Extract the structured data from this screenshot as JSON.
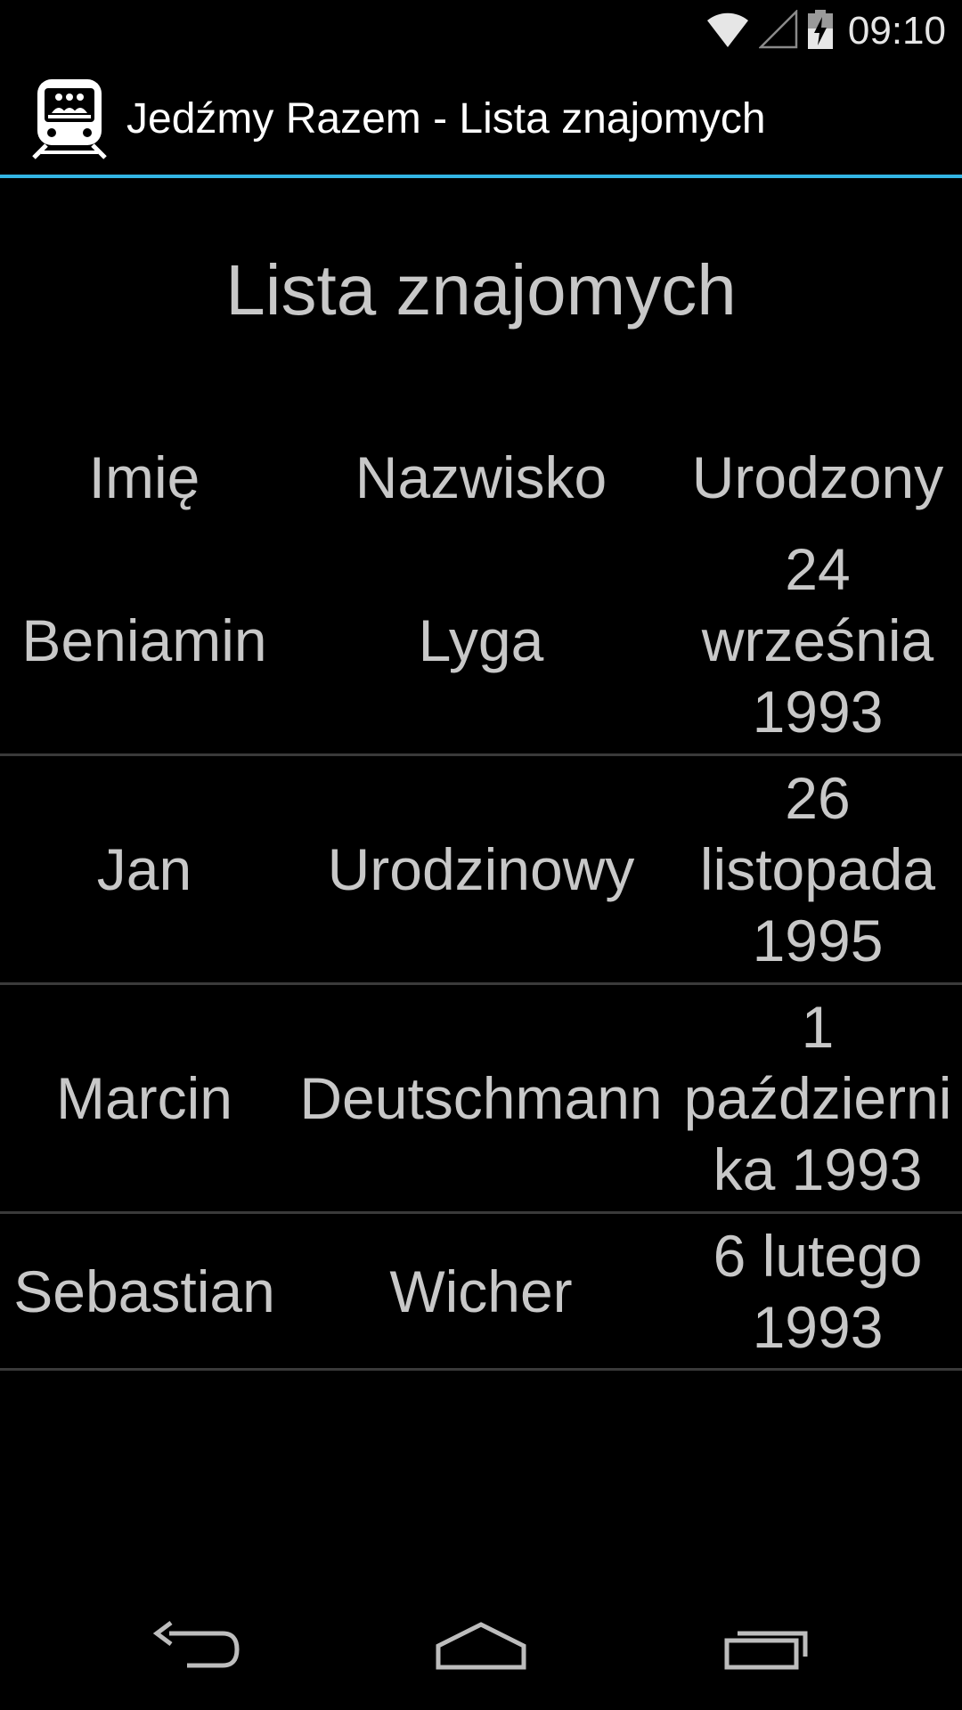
{
  "status_bar": {
    "time": "09:10",
    "icons": [
      "wifi-icon",
      "cell-signal-icon",
      "battery-charging-icon"
    ]
  },
  "action_bar": {
    "app_title": "Jedźmy Razem - Lista znajomych",
    "icon": "train-app-icon"
  },
  "main": {
    "page_title": "Lista znajomych",
    "table": {
      "headers": [
        "Imię",
        "Nazwisko",
        "Urodzony"
      ],
      "rows": [
        {
          "first_name": "Beniamin",
          "last_name": "Lyga",
          "born_line1": "24",
          "born_line2": "września",
          "born_line3": "1993"
        },
        {
          "first_name": "Jan",
          "last_name": "Urodzinowy",
          "born_line1": "26",
          "born_line2": "listopada",
          "born_line3": "1995"
        },
        {
          "first_name": "Marcin",
          "last_name": "Deutschmann",
          "born_line1": "1",
          "born_line2": "październi",
          "born_line3": "ka 1993"
        },
        {
          "first_name": "Sebastian",
          "last_name": "Wicher",
          "born_line1": "6 lutego",
          "born_line2": "1993"
        }
      ]
    }
  },
  "nav_bar": {
    "buttons": [
      "back-icon",
      "home-icon",
      "recent-apps-icon"
    ]
  },
  "colors": {
    "accent": "#33b5e5",
    "background": "#000000",
    "text": "#c8c8c8"
  }
}
